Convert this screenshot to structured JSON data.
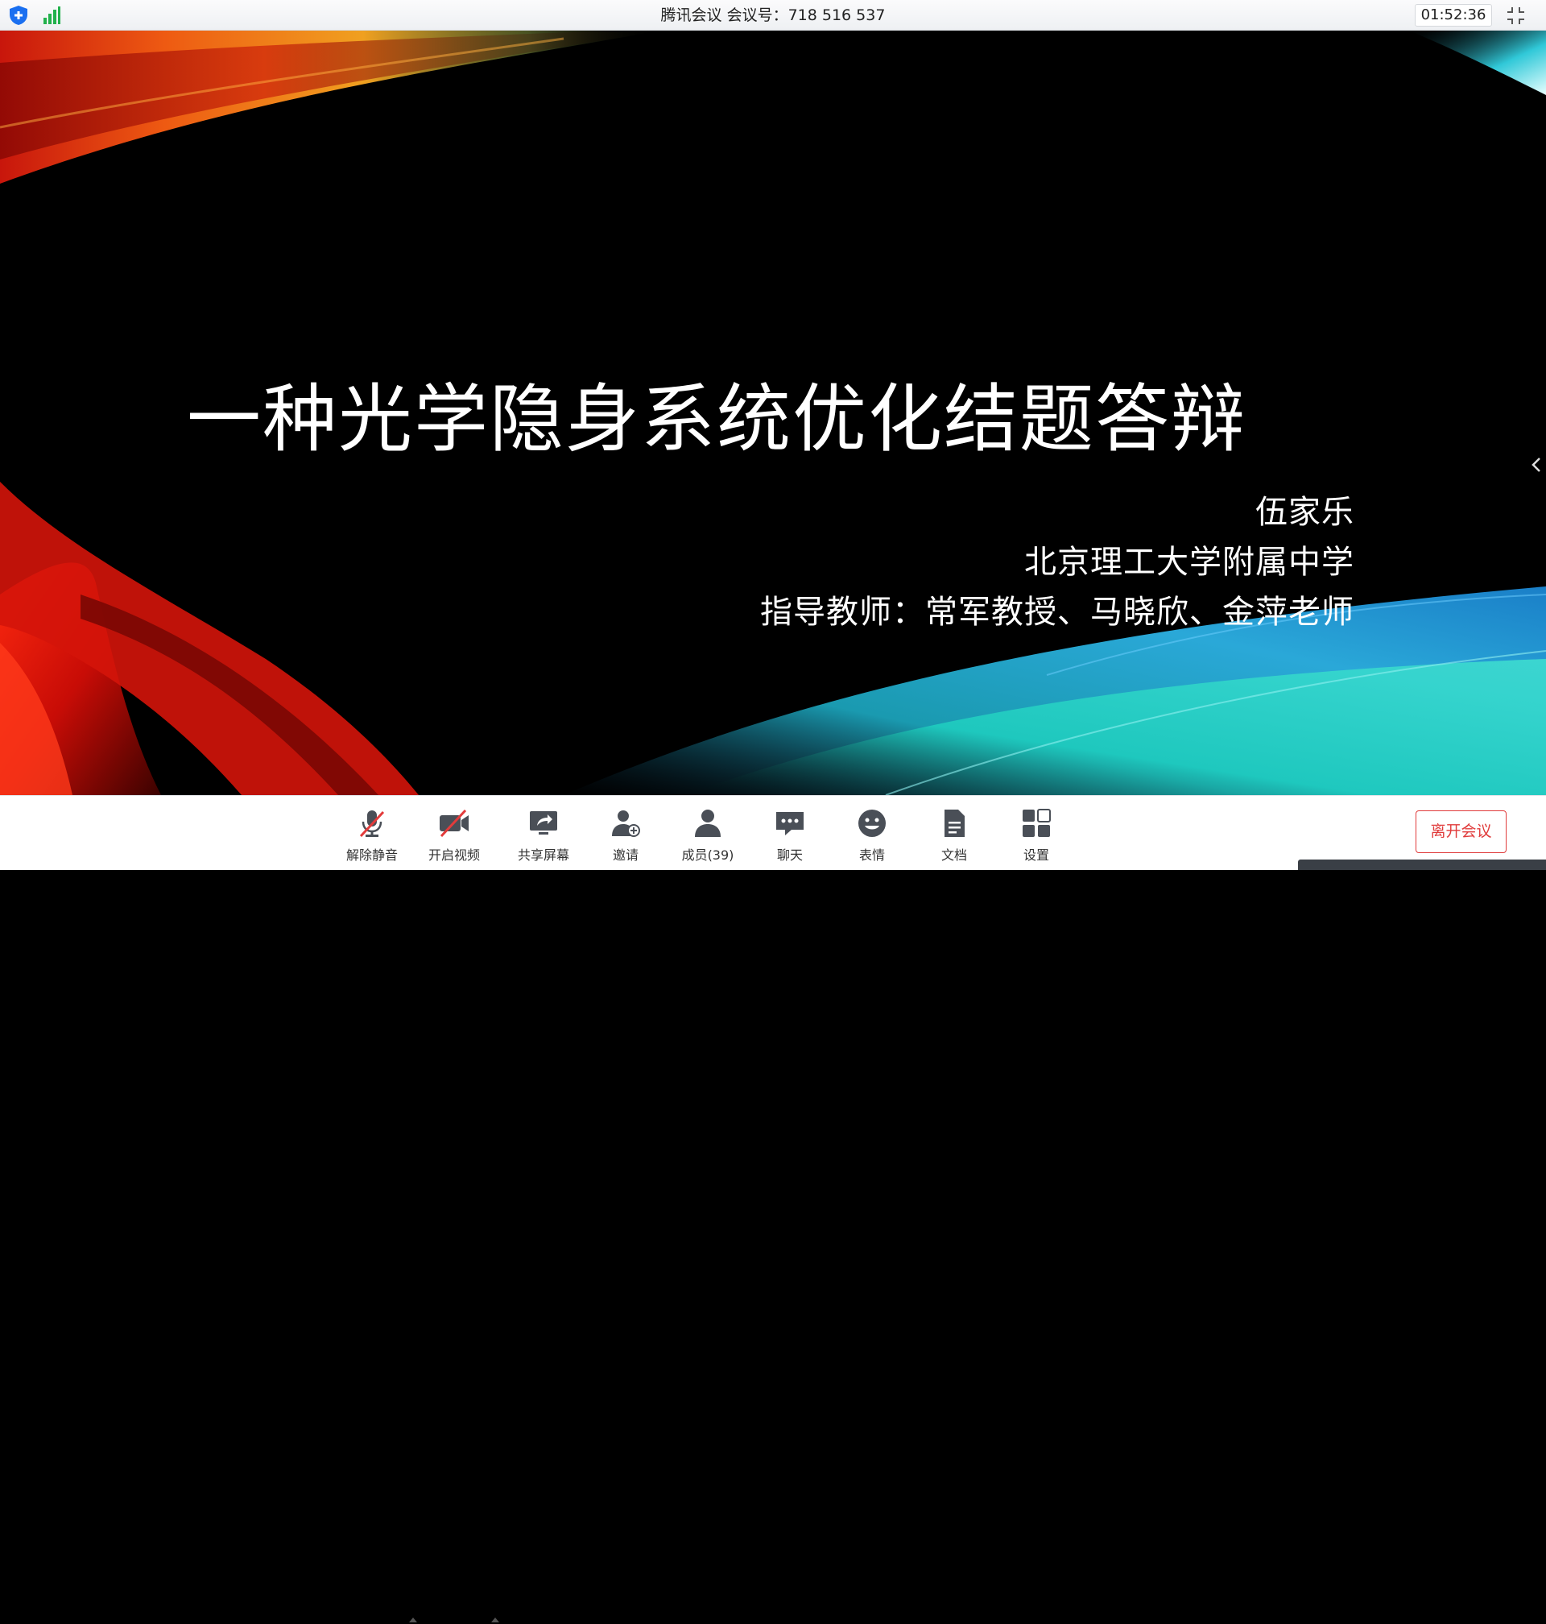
{
  "window": {
    "title": "腾讯会议 会议号：718 516 537",
    "timer": "01:52:36"
  },
  "slide": {
    "title": "一种光学隐身系统优化结题答辩",
    "author": "伍家乐",
    "school": "北京理工大学附属中学",
    "advisors": "指导教师：常军教授、马晓欣、金萍老师"
  },
  "toolbar": {
    "unmute": "解除静音",
    "video": "开启视频",
    "share": "共享屏幕",
    "invite": "邀请",
    "members": "成员(39)",
    "chat": "聊天",
    "emoji": "表情",
    "docs": "文档",
    "settings": "设置",
    "leave": "离开会议"
  },
  "colors": {
    "accent_blue": "#1a6ff0",
    "signal_green": "#22b14c",
    "leave_red": "#e03b3b",
    "muted_red": "#e33b3b",
    "icon_gray": "#4a4f57"
  },
  "icons": {
    "shield": "security-shield-icon",
    "signal": "signal-strength-icon",
    "exit_full": "exit-fullscreen-icon",
    "collapse": "chevron-left-icon"
  }
}
